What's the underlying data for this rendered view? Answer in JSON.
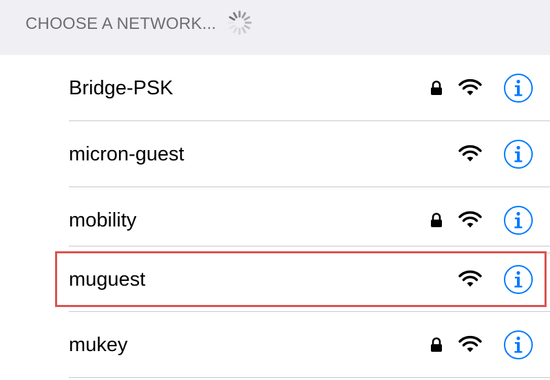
{
  "section": {
    "title": "CHOOSE A NETWORK..."
  },
  "networks": [
    {
      "name": "Bridge-PSK",
      "secured": true,
      "icons": [
        "lock-icon",
        "wifi-icon",
        "info-icon"
      ]
    },
    {
      "name": "micron-guest",
      "secured": false,
      "icons": [
        "wifi-icon",
        "info-icon"
      ]
    },
    {
      "name": "mobility",
      "secured": true,
      "icons": [
        "lock-icon",
        "wifi-icon",
        "info-icon"
      ]
    },
    {
      "name": "muguest",
      "secured": false,
      "highlighted": true,
      "icons": [
        "wifi-icon",
        "info-icon"
      ]
    },
    {
      "name": "mukey",
      "secured": true,
      "icons": [
        "lock-icon",
        "wifi-icon",
        "info-icon"
      ]
    }
  ],
  "colors": {
    "header_bg": "#efeff4",
    "header_text": "#6d6d72",
    "accent": "#007aff",
    "separator": "#c8c7cc",
    "highlight_border": "#d9534f"
  }
}
